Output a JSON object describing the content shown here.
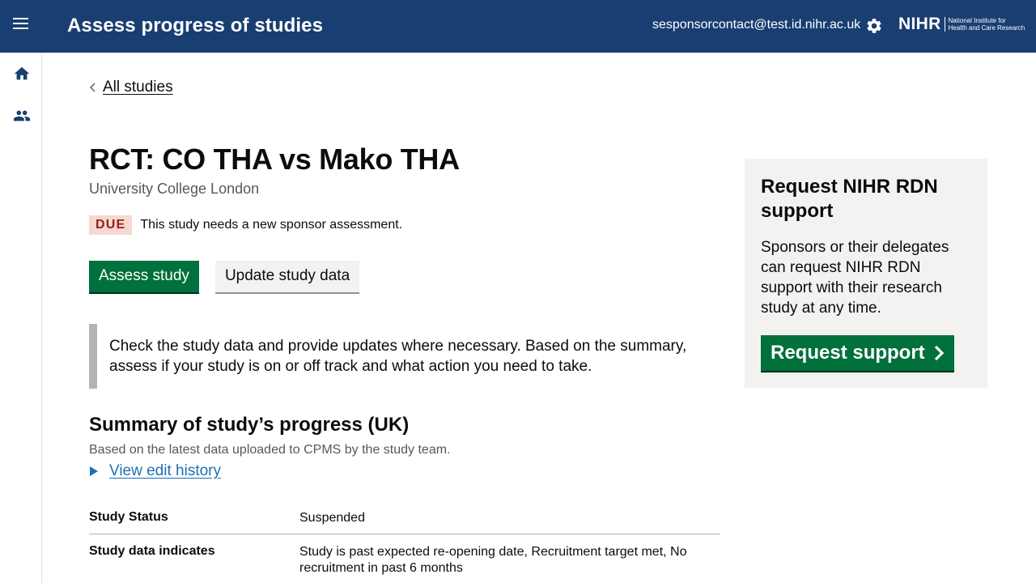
{
  "header": {
    "title": "Assess progress of studies",
    "user_email": "sesponsorcontact@test.id.nihr.ac.uk",
    "logo_mark": "NIHR",
    "logo_line1": "National Institute for",
    "logo_line2": "Health and Care Research"
  },
  "sidebar": {
    "items": [
      {
        "icon": "home-icon"
      },
      {
        "icon": "people-icon"
      }
    ]
  },
  "main": {
    "back_link": "All studies",
    "study_title": "RCT: CO THA vs Mako THA",
    "organisation": "University College London",
    "status_badge": "DUE",
    "status_text": "This study needs a new sponsor assessment.",
    "assess_button": "Assess study",
    "update_button": "Update study data",
    "inset_text": "Check the study data and provide updates where necessary. Based on the summary, assess if your study is on or off track and what action you need to take.",
    "summary_title": "Summary of study’s progress (UK)",
    "summary_subtitle": "Based on the latest data uploaded to CPMS by the study team.",
    "edit_history_link": "View edit history",
    "summary_rows": [
      {
        "key": "Study Status",
        "value": "Suspended"
      },
      {
        "key": "Study data indicates",
        "value": "Study is past expected re-opening date, Recruitment target met, No recruitment in past 6 months"
      }
    ]
  },
  "panel": {
    "title": "Request NIHR RDN support",
    "text": "Sponsors or their delegates can request NIHR RDN support with their research study at any time.",
    "button": "Request support"
  },
  "colors": {
    "header_bg": "#193e72",
    "primary_green": "#00703c",
    "link_blue": "#1d70b8",
    "due_bg": "#f6d7d2",
    "due_text": "#942514"
  }
}
